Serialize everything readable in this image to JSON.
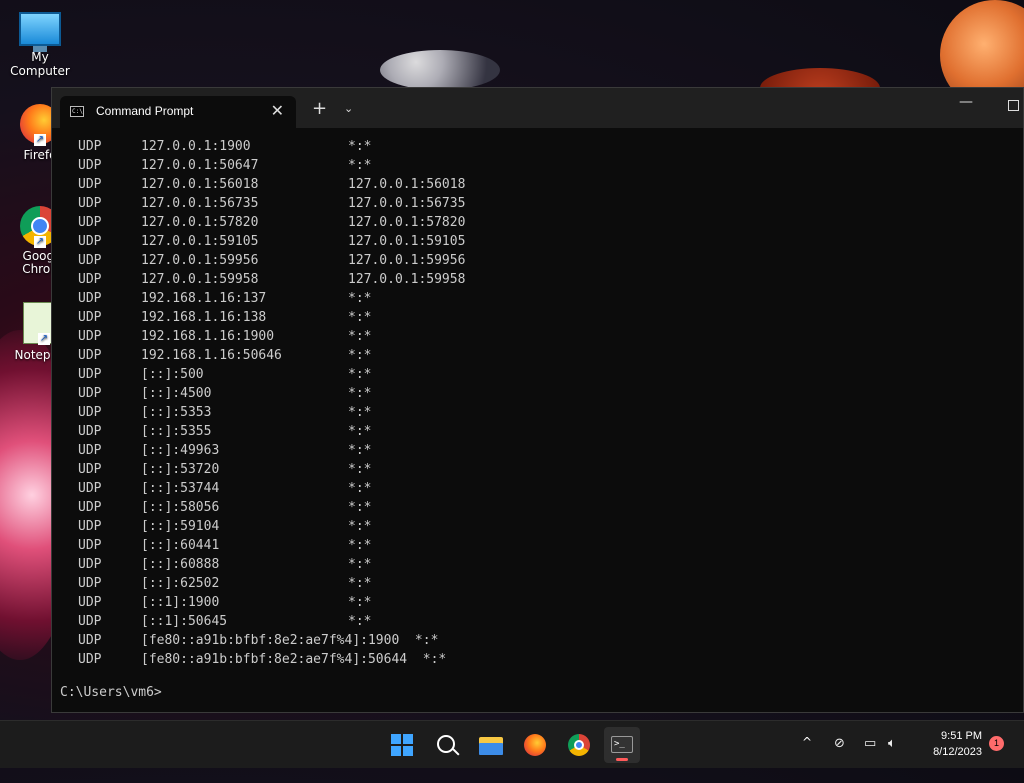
{
  "desktop": {
    "icons": [
      {
        "label": "My Computer",
        "icon": "computer-icon"
      },
      {
        "label": "Firefo",
        "icon": "firefox-icon"
      },
      {
        "label": "Googl\nChron",
        "icon": "chrome-icon"
      },
      {
        "label": "Notepad",
        "icon": "notepad-icon"
      }
    ]
  },
  "window": {
    "tab_title": "Command Prompt",
    "close_symbol": "✕",
    "new_tab_symbol": "+",
    "dropdown_symbol": "⌄",
    "minimize_symbol": "—"
  },
  "terminal": {
    "rows": [
      [
        "UDP",
        "127.0.0.1:1900",
        "*:*"
      ],
      [
        "UDP",
        "127.0.0.1:50647",
        "*:*"
      ],
      [
        "UDP",
        "127.0.0.1:56018",
        "127.0.0.1:56018"
      ],
      [
        "UDP",
        "127.0.0.1:56735",
        "127.0.0.1:56735"
      ],
      [
        "UDP",
        "127.0.0.1:57820",
        "127.0.0.1:57820"
      ],
      [
        "UDP",
        "127.0.0.1:59105",
        "127.0.0.1:59105"
      ],
      [
        "UDP",
        "127.0.0.1:59956",
        "127.0.0.1:59956"
      ],
      [
        "UDP",
        "127.0.0.1:59958",
        "127.0.0.1:59958"
      ],
      [
        "UDP",
        "192.168.1.16:137",
        "*:*"
      ],
      [
        "UDP",
        "192.168.1.16:138",
        "*:*"
      ],
      [
        "UDP",
        "192.168.1.16:1900",
        "*:*"
      ],
      [
        "UDP",
        "192.168.1.16:50646",
        "*:*"
      ],
      [
        "UDP",
        "[::]:500",
        "*:*"
      ],
      [
        "UDP",
        "[::]:4500",
        "*:*"
      ],
      [
        "UDP",
        "[::]:5353",
        "*:*"
      ],
      [
        "UDP",
        "[::]:5355",
        "*:*"
      ],
      [
        "UDP",
        "[::]:49963",
        "*:*"
      ],
      [
        "UDP",
        "[::]:53720",
        "*:*"
      ],
      [
        "UDP",
        "[::]:53744",
        "*:*"
      ],
      [
        "UDP",
        "[::]:58056",
        "*:*"
      ],
      [
        "UDP",
        "[::]:59104",
        "*:*"
      ],
      [
        "UDP",
        "[::]:60441",
        "*:*"
      ],
      [
        "UDP",
        "[::]:60888",
        "*:*"
      ],
      [
        "UDP",
        "[::]:62502",
        "*:*"
      ],
      [
        "UDP",
        "[::1]:1900",
        "*:*"
      ],
      [
        "UDP",
        "[::1]:50645",
        "*:*"
      ],
      [
        "UDP",
        "[fe80::a91b:bfbf:8e2:ae7f%4]:1900  *:*",
        ""
      ],
      [
        "UDP",
        "[fe80::a91b:bfbf:8e2:ae7f%4]:50644  *:*",
        ""
      ]
    ],
    "prompt": "C:\\Users\\vm6>"
  },
  "taskbar": {
    "apps": [
      "start-icon",
      "search-icon",
      "file-explorer-icon",
      "firefox-icon",
      "chrome-icon",
      "terminal-icon"
    ],
    "tray_chevron": "^",
    "clock_time": "9:51 PM",
    "clock_date": "8/12/2023",
    "notification_count": "1"
  }
}
